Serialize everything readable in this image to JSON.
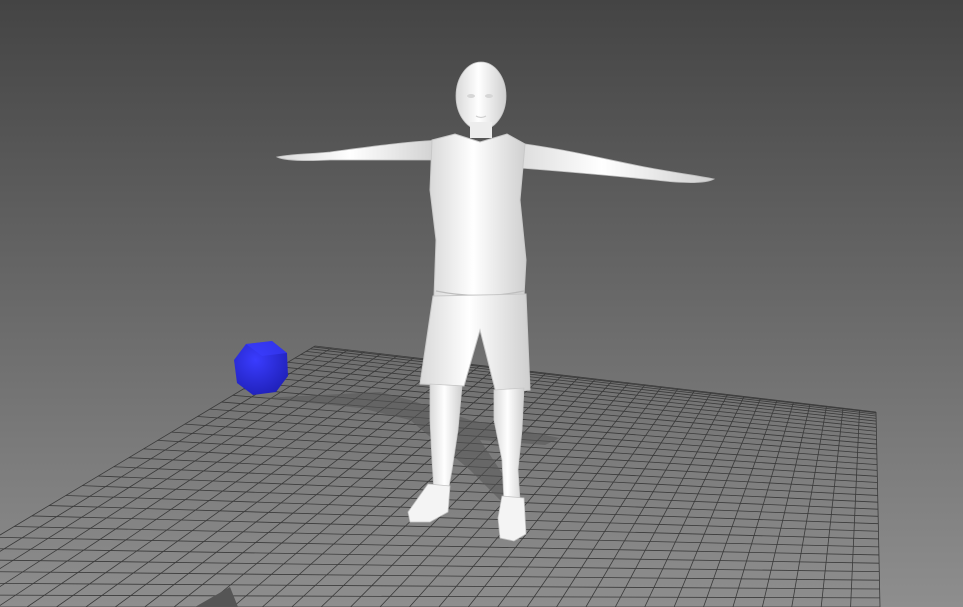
{
  "scene": {
    "background_top": "#444444",
    "background_bottom": "#8e8e8e",
    "floor_grid_color": "#3a3a3a",
    "mannequin_color": "#f2f2f2",
    "mannequin_shade": "#cfcfcf",
    "object_color": "#2b2de0",
    "object_shape": "polyhedron",
    "pose": "T-pose"
  }
}
